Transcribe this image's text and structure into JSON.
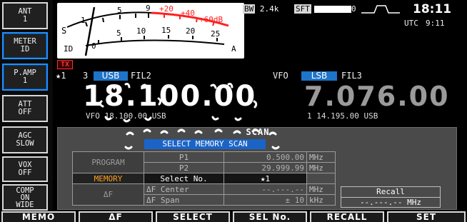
{
  "side_keys": [
    {
      "lines": [
        "ANT",
        "1"
      ]
    },
    {
      "lines": [
        "METER",
        "ID"
      ]
    },
    {
      "lines": [
        "P.AMP",
        "1"
      ]
    },
    {
      "lines": [
        "ATT",
        "OFF"
      ]
    },
    {
      "lines": [
        "AGC",
        "SLOW"
      ]
    },
    {
      "lines": [
        "VOX",
        "OFF"
      ]
    },
    {
      "lines": [
        "COMP",
        "ON",
        "WIDE"
      ]
    }
  ],
  "bottom_keys": [
    "MEMO",
    "ΔF",
    "SELECT",
    "SEL No.",
    "RECALL",
    "SET"
  ],
  "meter": {
    "s_label": "S",
    "id_label": "ID",
    "a_label": "A",
    "upper_scale": [
      "1",
      "5",
      "9",
      "+20",
      "+40",
      "+60dB"
    ],
    "lower_scale": [
      "0",
      "5",
      "10",
      "15",
      "20",
      "25"
    ],
    "colors": {
      "normal": "#000000",
      "over": "#ff2020",
      "needle": "#000000"
    }
  },
  "status": {
    "bw_label": "BW",
    "bw_value": "2.4k",
    "sft_label": "SFT",
    "sft_value": "0",
    "clock": "18:11",
    "utc_label": "UTC",
    "utc_time": "9:11"
  },
  "main_vfo": {
    "tx_badge": "TX",
    "star_label": "★1",
    "number": "3",
    "mode": "USB",
    "filter": "FIL2",
    "frequency": "18.100.00",
    "sub_line": "VFO 18.100.00 USB"
  },
  "sub_vfo": {
    "vfo_label": "VFO",
    "mode": "LSB",
    "filter": "FIL3",
    "frequency": "7.076.00",
    "sub_line": "1 14.195.00 USB"
  },
  "scan": {
    "title": "SCAN",
    "banner": "SELECT MEMORY SCAN",
    "rows": [
      {
        "mode": "PROGRAM",
        "param": "P1",
        "value": "0.500.00",
        "unit": "MHz"
      },
      {
        "mode": "",
        "param": "P2",
        "value": "29.999.99",
        "unit": "MHz"
      },
      {
        "mode": "MEMORY",
        "param": "Select No.",
        "value": "★1",
        "unit": ""
      },
      {
        "mode": "ΔF",
        "param": "ΔF  Center",
        "value": "--.---.--",
        "unit": "MHz"
      },
      {
        "mode": "",
        "param": "ΔF  Span",
        "value": "±  10",
        "unit": "kHz"
      }
    ],
    "recall_title": "Recall",
    "recall_value": "--.---.--",
    "recall_unit": "MHz"
  },
  "colors": {
    "accent_blue": "#1e74c9",
    "active_key": "#1e90ff",
    "memory_orange": "#ffa020",
    "tx_red": "#ff3030"
  }
}
